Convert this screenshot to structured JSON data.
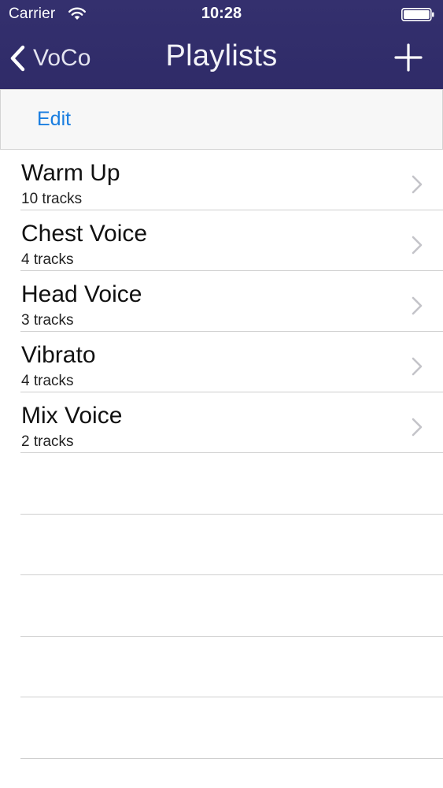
{
  "status_bar": {
    "carrier": "Carrier",
    "time": "10:28"
  },
  "nav": {
    "back_label": "VoCo",
    "title": "Playlists",
    "add_icon": "plus-icon"
  },
  "toolbar": {
    "edit_label": "Edit"
  },
  "playlists": [
    {
      "title": "Warm Up",
      "subtitle": "10 tracks"
    },
    {
      "title": "Chest Voice",
      "subtitle": "4 tracks"
    },
    {
      "title": "Head Voice",
      "subtitle": "3 tracks"
    },
    {
      "title": "Vibrato",
      "subtitle": "4 tracks"
    },
    {
      "title": "Mix Voice",
      "subtitle": "2 tracks"
    }
  ],
  "colors": {
    "nav_background": "#2f2b68",
    "accent": "#1a7ee0",
    "separator": "#cfcfcf"
  }
}
